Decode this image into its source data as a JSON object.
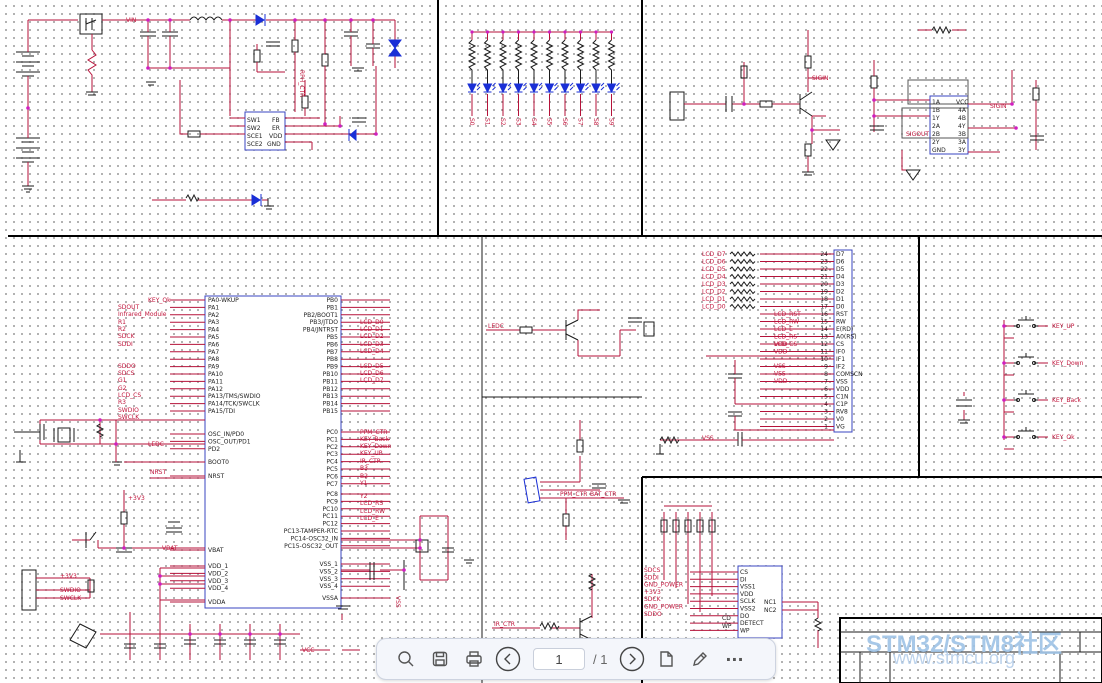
{
  "schematic": {
    "net_labels_left_mcu": [
      "KEY_Ok",
      "SDOUT",
      "Infrared_Module",
      "R1",
      "R2",
      "SDCK",
      "SDDI",
      "SDDO",
      "SDCS",
      "G1",
      "G2",
      "LCD_CS",
      "R3",
      "SWDIO",
      "SWCLK",
      "LEDC",
      "NRST",
      "+3V3",
      "VBAT"
    ],
    "mcu_left_pins": [
      "PA0-WKUP",
      "PA1",
      "PA2",
      "PA3",
      "PA4",
      "PA5",
      "PA6",
      "PA7",
      "PA8",
      "PA9",
      "PA10",
      "PA11",
      "PA12",
      "PA13/TMS/SWDIO",
      "PA14/TCK/SWCLK",
      "PA15/TDI",
      "OSC_IN/PD0",
      "OSC_OUT/PD1",
      "PD2",
      "BOOT0",
      "NRST",
      "VBAT",
      "VDD_1",
      "VDD_2",
      "VDD_3",
      "VDD_4",
      "VDDA"
    ],
    "mcu_right_pins": [
      "PB0",
      "PB1",
      "PB2/BOOT1",
      "PB3/JTDO",
      "PB4/JNTRST",
      "PB5",
      "PB6",
      "PB7",
      "PB8",
      "PB9",
      "PB10",
      "PB11",
      "PB12",
      "PB13",
      "PB14",
      "PB15",
      "PC0",
      "PC1",
      "PC2",
      "PC3",
      "PC4",
      "PC5",
      "PC6",
      "PC7",
      "PC8",
      "PC9",
      "PC10",
      "PC11",
      "PC12",
      "PC13-TAMPER-RTC",
      "PC14-OSC32_IN",
      "PC15-OSC32_OUT",
      "VSS_1",
      "VSS_2",
      "VSS_3",
      "VSS_4",
      "VSSA"
    ],
    "mcu_right_labels": [
      "LCD_D0",
      "LCD_D1",
      "LCD_D2",
      "LCD_D3",
      "LCD_D4",
      "LCD_D5",
      "LCD_D6",
      "LCD_D7",
      "PPM_CTR",
      "KEY_Back",
      "KEY_Down",
      "KEY_UP",
      "IR_CTR",
      "B3",
      "B2",
      "Y1",
      "Y2",
      "LCD_RS",
      "LCD_RW",
      "LCD_E"
    ],
    "lcd_pins": [
      "D7",
      "D6",
      "D5",
      "D4",
      "D3",
      "D2",
      "D1",
      "D0",
      "RST",
      "RW",
      "E(RD)",
      "A0(RS)",
      "CS",
      "IF0",
      "IF1",
      "IF2",
      "COMSCN",
      "VSS",
      "VDD",
      "C1N",
      "C1P",
      "RV8",
      "V0",
      "VG"
    ],
    "lcd_labels": [
      "LCD_D7",
      "LCD_D6",
      "LCD_D5",
      "LCD_D4",
      "LCD_D3",
      "LCD_D2",
      "LCD_D1",
      "LCD_D0",
      "LCD_RST",
      "LCD_RW",
      "LCD_E",
      "LCD_RS",
      "LCD_CS",
      "VDD",
      "VDD",
      "VSS",
      "VSS",
      "VDD"
    ],
    "keys": [
      "KEY_UP",
      "KEY_Down",
      "KEY_Back",
      "KEY_Ok"
    ],
    "power_ic_pins_left": [
      "SW1",
      "SW2",
      "SCE1",
      "SCE2"
    ],
    "power_ic_pins_right": [
      "FB",
      "ER",
      "VDD",
      "GND"
    ],
    "level_ic_pins_left": [
      "1A",
      "1B",
      "1Y",
      "2A",
      "2B",
      "2Y",
      "GND"
    ],
    "level_ic_pins_right": [
      "VCC",
      "4A",
      "4B",
      "4Y",
      "3B",
      "3A",
      "3Y"
    ],
    "sd_pins": [
      "CS",
      "DI",
      "VSS1",
      "VDD",
      "SCLK",
      "VSS2",
      "DO",
      "DETECT",
      "WP"
    ],
    "sd_pins_right": [
      "NC1",
      "NC2"
    ],
    "sd_labels": [
      "SDCS",
      "SDDI",
      "GND_POWER",
      "+3V3",
      "SDCK",
      "GND_POWER",
      "SDDO"
    ],
    "misc_labels": [
      "VIN",
      "EN",
      "SIGIN",
      "SIGOUT",
      "PPM_CTR",
      "IR_CTR",
      "BAT_CTR",
      "LEDC",
      "VSS",
      "CD",
      "WP",
      "R_CTR",
      "SIGOUT",
      "+3V3"
    ],
    "led_pins": [
      "S0",
      "S1",
      "S2",
      "S3",
      "S4",
      "S5",
      "S6",
      "S7",
      "S8",
      "S9"
    ]
  },
  "watermark": {
    "line1": "STM32/STM8社区",
    "line2": "www.stmcu.org"
  },
  "toolbar": {
    "search_icon": "search-icon",
    "save_icon": "save-icon",
    "print_icon": "print-icon",
    "prev_icon": "chevron-left-icon",
    "next_icon": "chevron-right-icon",
    "page_current": "1",
    "page_total": "/ 1",
    "page_icon": "page-icon",
    "annotate_icon": "pen-icon",
    "more_label": "···"
  }
}
